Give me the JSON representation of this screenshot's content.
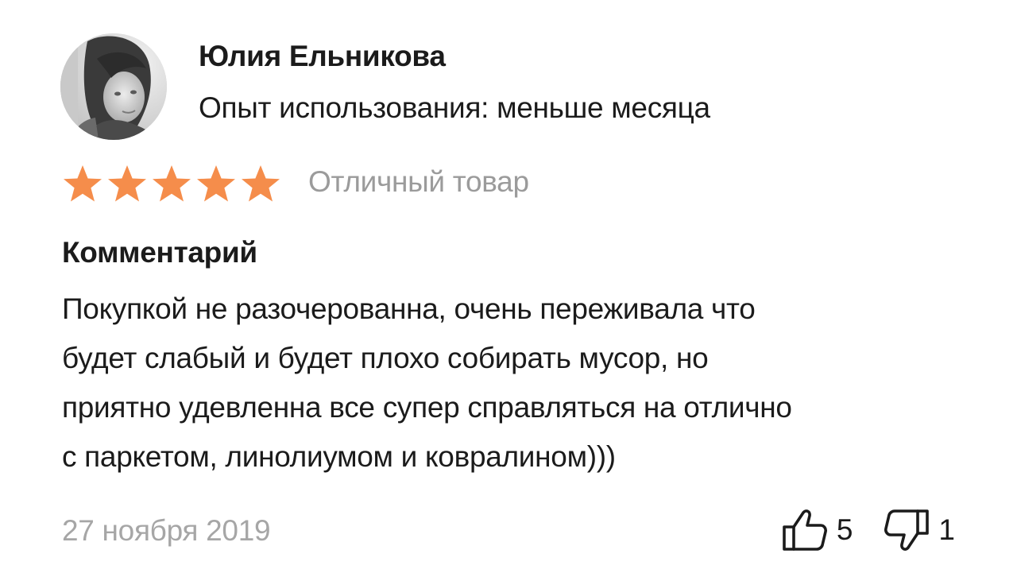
{
  "review": {
    "author": {
      "name": "Юлия Ельникова",
      "experience": "Опыт использования: меньше месяца"
    },
    "rating": {
      "stars": 5,
      "max_stars": 5,
      "label": "Отличный товар",
      "star_color": "#f58d4b"
    },
    "comment": {
      "title": "Комментарий",
      "lines": [
        "Покупкой не разочерованна, очень переживала что",
        "будет слабый и будет плохо собирать мусор, но",
        "приятно удевленна все супер справляться на отлично",
        "с паркетом, линолиумом и ковралином)))"
      ]
    },
    "date": "27 ноября 2019",
    "votes": {
      "likes": "5",
      "dislikes": "1",
      "like_icon": "thumbs-up-icon",
      "dislike_icon": "thumbs-down-icon"
    }
  }
}
